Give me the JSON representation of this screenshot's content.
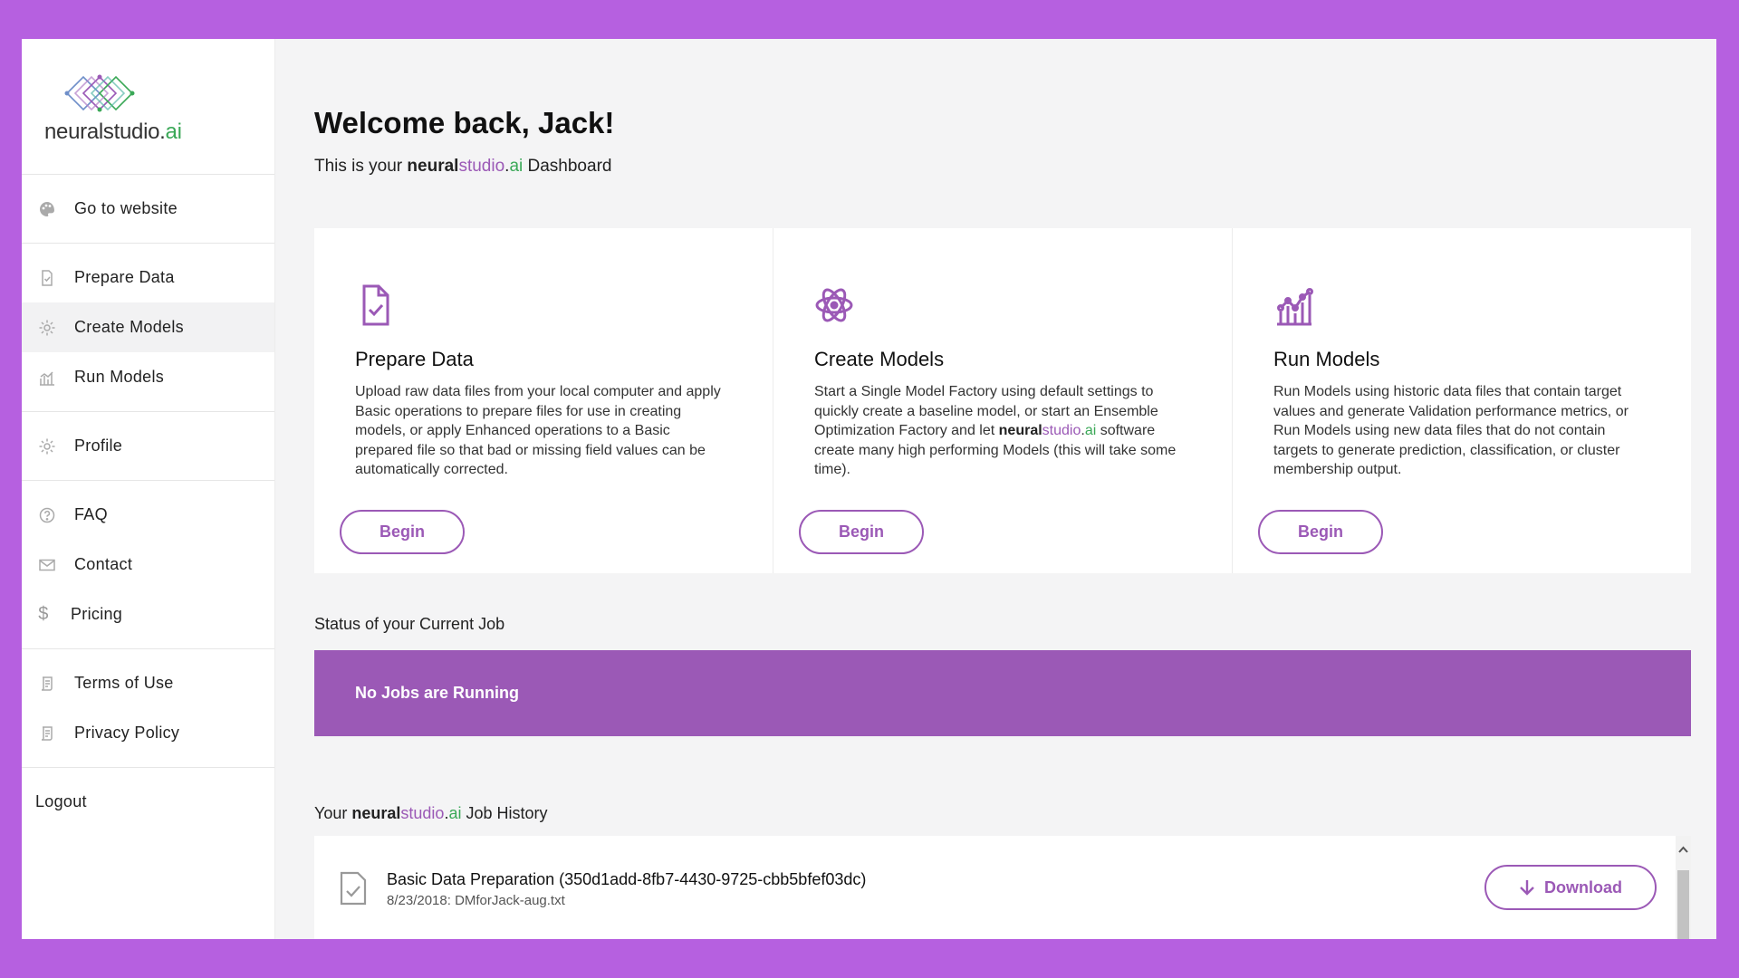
{
  "brand": {
    "name_prefix": "neural",
    "name_mid": "studio",
    "name_dot": ".",
    "name_suffix": "ai"
  },
  "sidebar": {
    "groups": [
      [
        {
          "label": "Go to website",
          "icon": "palette-icon"
        }
      ],
      [
        {
          "label": "Prepare Data",
          "icon": "document-check-icon"
        },
        {
          "label": "Create Models",
          "icon": "gear-icon",
          "active": true
        },
        {
          "label": "Run Models",
          "icon": "bar-chart-icon"
        }
      ],
      [
        {
          "label": "Profile",
          "icon": "gear-icon"
        }
      ],
      [
        {
          "label": "FAQ",
          "icon": "help-circle-icon"
        },
        {
          "label": "Contact",
          "icon": "envelope-icon"
        },
        {
          "label": "Pricing",
          "icon": "dollar-icon"
        }
      ],
      [
        {
          "label": "Terms of Use",
          "icon": "scroll-icon"
        },
        {
          "label": "Privacy Policy",
          "icon": "scroll-icon"
        }
      ]
    ],
    "logout": "Logout"
  },
  "header": {
    "welcome": "Welcome back, Jack!",
    "subtitle_pre": "This is your ",
    "subtitle_post": " Dashboard"
  },
  "cards": [
    {
      "title": "Prepare Data",
      "icon": "document-check-icon",
      "description": "Upload raw data files from your local computer and apply Basic operations to prepare files for use in creating models, or apply Enhanced operations to a Basic prepared file so that bad or missing field values can be automatically corrected.",
      "button": "Begin"
    },
    {
      "title": "Create Models",
      "icon": "atom-icon",
      "description_pre": "Start a Single Model Factory using default settings to quickly create a baseline model, or start an Ensemble Optimization Factory and let ",
      "description_post": " software create many high performing Models (this will take some time).",
      "button": "Begin"
    },
    {
      "title": "Run Models",
      "icon": "chart-growth-icon",
      "description": "Run Models using historic data files that contain target values and generate Validation performance metrics, or Run Models using new data files that do not contain targets to generate prediction, classification, or cluster membership output.",
      "button": "Begin"
    }
  ],
  "status": {
    "label": "Status of your Current Job",
    "message": "No Jobs are Running"
  },
  "history": {
    "label_pre": "Your ",
    "label_post": " Job History",
    "items": [
      {
        "title": "Basic Data Preparation (350d1add-8fb7-4430-9725-cbb5bfef03dc)",
        "subtitle": "8/23/2018: DMforJack-aug.txt",
        "button": "Download"
      }
    ]
  },
  "colors": {
    "frame": "#b660e0",
    "accent": "#9b59b6",
    "brand_green": "#3aa857"
  }
}
